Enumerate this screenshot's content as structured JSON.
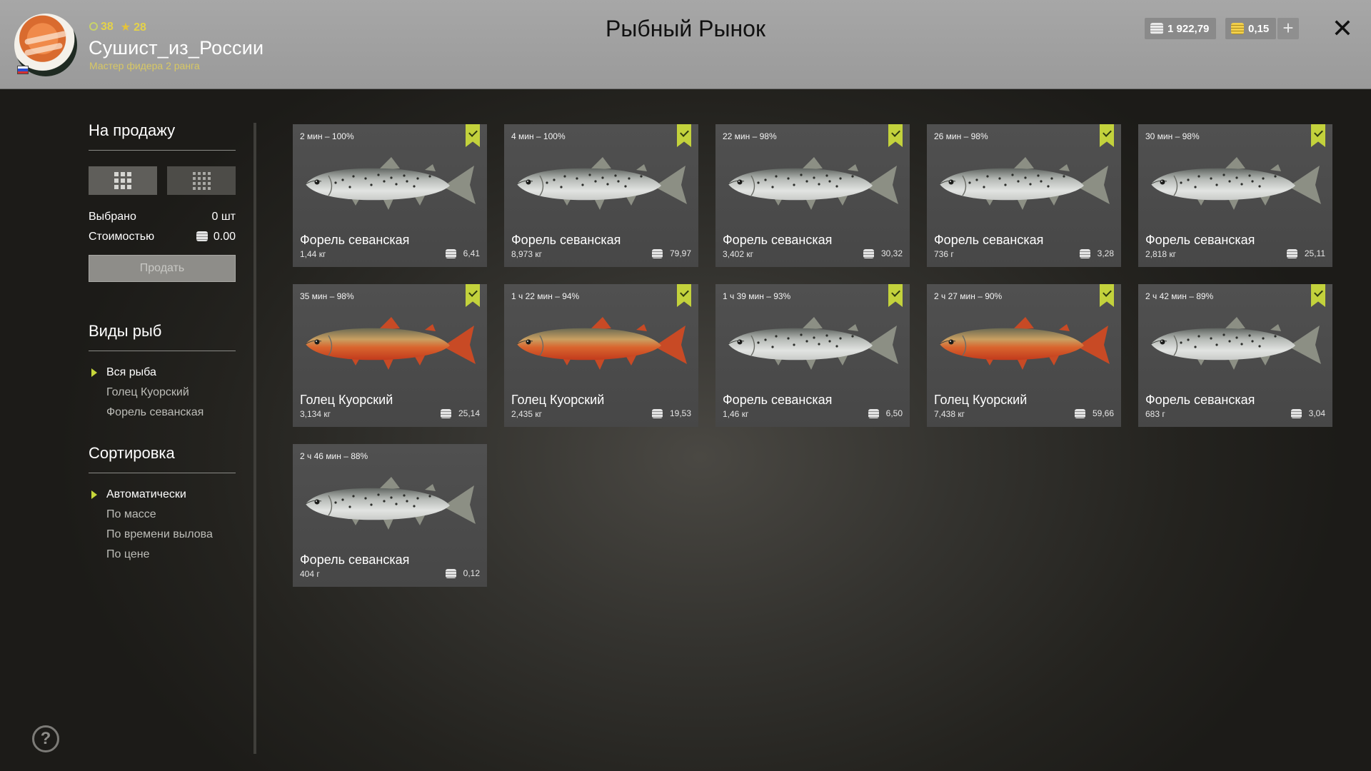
{
  "header": {
    "title": "Рыбный Рынок",
    "username": "Сушист_из_России",
    "rank": "Мастер фидера 2 ранга",
    "level": "38",
    "stars": "28",
    "silver": "1 922,79",
    "gold": "0,15"
  },
  "sidebar": {
    "for_sale_title": "На продажу",
    "selected_label": "Выбрано",
    "selected_value": "0 шт",
    "cost_label": "Стоимостью",
    "cost_value": "0.00",
    "sell_button": "Продать",
    "species_title": "Виды рыб",
    "species": [
      "Вся рыба",
      "Голец Куорский",
      "Форель севанская"
    ],
    "sort_title": "Сортировка",
    "sort_options": [
      "Автоматически",
      "По массе",
      "По времени вылова",
      "По цене"
    ]
  },
  "fish": [
    {
      "time": "2 мин – 100%",
      "name": "Форель севанская",
      "weight": "1,44 кг",
      "price": "6,41",
      "kind": "trout"
    },
    {
      "time": "4 мин – 100%",
      "name": "Форель севанская",
      "weight": "8,973 кг",
      "price": "79,97",
      "kind": "trout"
    },
    {
      "time": "22 мин – 98%",
      "name": "Форель севанская",
      "weight": "3,402 кг",
      "price": "30,32",
      "kind": "trout"
    },
    {
      "time": "26 мин – 98%",
      "name": "Форель севанская",
      "weight": "736 г",
      "price": "3,28",
      "kind": "trout"
    },
    {
      "time": "30 мин – 98%",
      "name": "Форель севанская",
      "weight": "2,818 кг",
      "price": "25,11",
      "kind": "trout"
    },
    {
      "time": "35 мин – 98%",
      "name": "Голец Куорский",
      "weight": "3,134 кг",
      "price": "25,14",
      "kind": "char"
    },
    {
      "time": "1 ч 22 мин – 94%",
      "name": "Голец Куорский",
      "weight": "2,435 кг",
      "price": "19,53",
      "kind": "char"
    },
    {
      "time": "1 ч 39 мин – 93%",
      "name": "Форель севанская",
      "weight": "1,46 кг",
      "price": "6,50",
      "kind": "trout"
    },
    {
      "time": "2 ч 27 мин – 90%",
      "name": "Голец Куорский",
      "weight": "7,438 кг",
      "price": "59,66",
      "kind": "char"
    },
    {
      "time": "2 ч 42 мин – 89%",
      "name": "Форель севанская",
      "weight": "683 г",
      "price": "3,04",
      "kind": "trout"
    },
    {
      "time": "2 ч 46 мин – 88%",
      "name": "Форель севанская",
      "weight": "404 г",
      "price": "0,12",
      "kind": "trout"
    }
  ],
  "colors": {
    "accent": "#c3d23c",
    "header_bg": "#a3a3a3",
    "card_bg": "#4d4d4d"
  },
  "icons": [
    "fish-icon",
    "bookmark-check-icon",
    "coin-icon",
    "gold-coin-icon",
    "plus-icon",
    "close-icon",
    "help-icon",
    "grid-large-icon",
    "grid-small-icon"
  ]
}
